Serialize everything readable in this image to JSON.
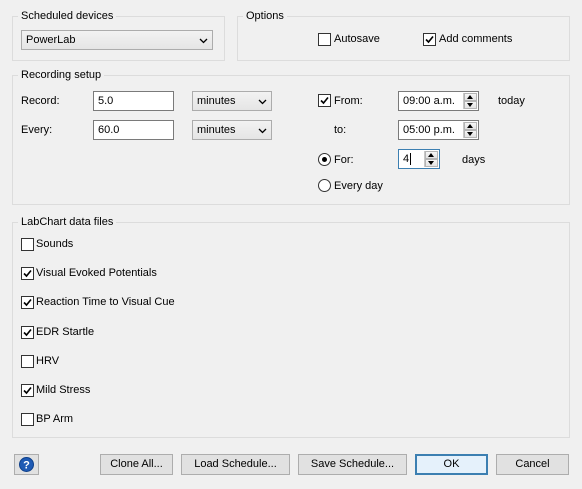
{
  "scheduled_devices": {
    "label": "Scheduled devices",
    "selected": "PowerLab"
  },
  "options": {
    "label": "Options",
    "autosave": {
      "label": "Autosave",
      "checked": false
    },
    "add_comments": {
      "label": "Add comments",
      "checked": true
    }
  },
  "recording": {
    "label": "Recording setup",
    "record_label": "Record:",
    "record_value": "5.0",
    "record_unit": "minutes",
    "every_label": "Every:",
    "every_value": "60.0",
    "every_unit": "minutes",
    "from": {
      "label": "From:",
      "checked": true,
      "value": "09:00 a.m.",
      "suffix": "today"
    },
    "to": {
      "label": "to:",
      "value": "05:00 p.m."
    },
    "for": {
      "label": "For:",
      "selected": true,
      "value": "4",
      "suffix": "days"
    },
    "every_day": {
      "label": "Every day",
      "selected": false
    }
  },
  "data_files": {
    "label": "LabChart data files",
    "items": [
      {
        "label": "Sounds",
        "checked": false
      },
      {
        "label": "Visual Evoked Potentials",
        "checked": true
      },
      {
        "label": "Reaction Time to Visual Cue",
        "checked": true
      },
      {
        "label": "EDR Startle",
        "checked": true
      },
      {
        "label": "HRV",
        "checked": false
      },
      {
        "label": "Mild Stress",
        "checked": true
      },
      {
        "label": "BP Arm",
        "checked": false
      }
    ]
  },
  "buttons": {
    "help_icon": "question-icon",
    "clone_all": "Clone All...",
    "load_schedule": "Load Schedule...",
    "save_schedule": "Save Schedule...",
    "ok": "OK",
    "cancel": "Cancel"
  },
  "colors": {
    "help_blue": "#1e5ab4",
    "focus_border": "#3c7fb1"
  }
}
